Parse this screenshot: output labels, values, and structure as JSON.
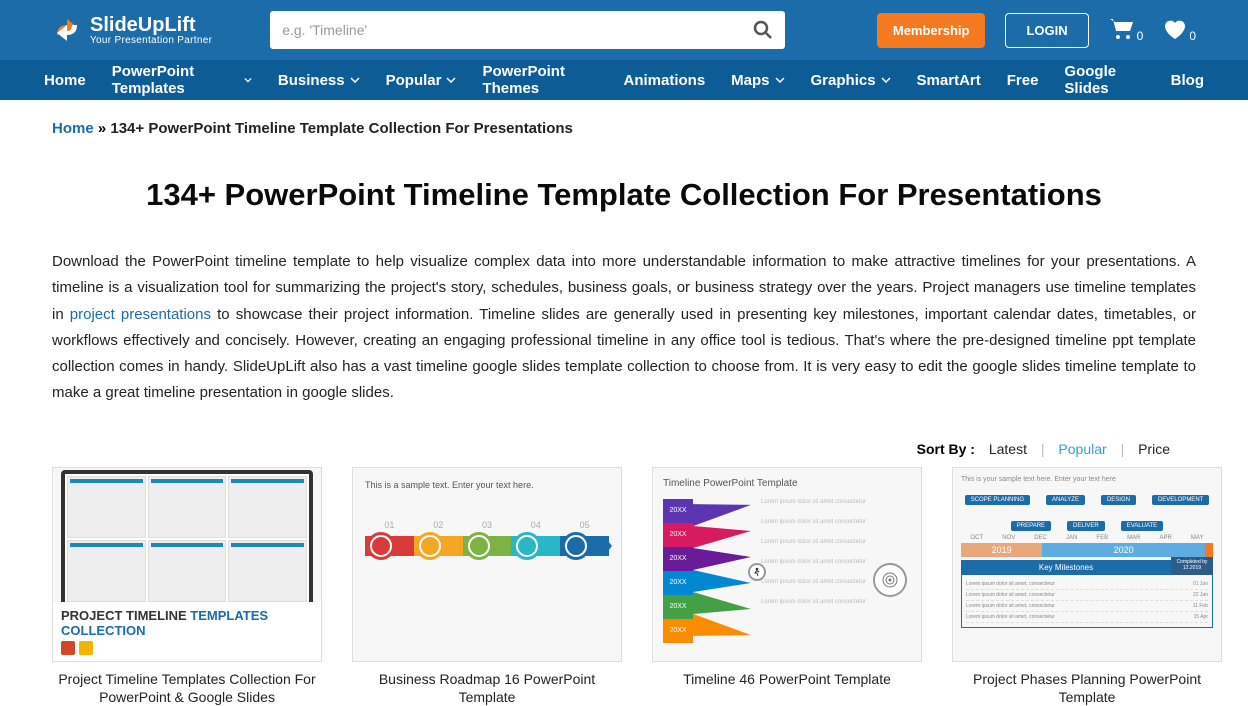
{
  "header": {
    "logo_title": "SlideUpLift",
    "logo_sub": "Your Presentation Partner",
    "search_placeholder": "e.g. 'Timeline'",
    "membership": "Membership",
    "login": "LOGIN",
    "cart_count": "0",
    "heart_count": "0"
  },
  "nav": {
    "items": [
      "Home",
      "PowerPoint Templates",
      "Business",
      "Popular",
      "PowerPoint Themes",
      "Animations",
      "Maps",
      "Graphics",
      "SmartArt",
      "Free",
      "Google Slides",
      "Blog"
    ],
    "dropdowns": [
      false,
      true,
      true,
      true,
      false,
      false,
      true,
      true,
      false,
      false,
      false,
      false
    ]
  },
  "breadcrumb": {
    "home": "Home",
    "sep": "»",
    "current": "134+ PowerPoint Timeline Template Collection For Presentations"
  },
  "page_title": "134+ PowerPoint Timeline Template Collection For Presentations",
  "desc": {
    "part1": "Download the PowerPoint timeline template to help visualize complex data into more understandable information to make attractive timelines for your presentations. A timeline is a visualization tool for summarizing the project's story, schedules, business goals, or business strategy over the years. Project managers use timeline templates in ",
    "link": "project presentations",
    "part2": " to showcase their project information. Timeline slides are generally used in presenting key milestones,  important calendar dates, timetables, or workflows effectively and concisely. However, creating an engaging professional timeline in any office tool is tedious. That's where the pre-designed timeline ppt template collection comes in handy. SlideUpLift also has a vast timeline google slides template collection to choose from. It is very easy to edit the google slides timeline template to make a great timeline presentation in google slides."
  },
  "sort": {
    "label": "Sort By :",
    "latest": "Latest",
    "popular": "Popular",
    "price": "Price"
  },
  "cards": [
    {
      "title": "Project Timeline Templates Collection For PowerPoint & Google Slides",
      "thumb_title1": "PROJECT TIMELINE ",
      "thumb_title2": "TEMPLATES",
      "thumb_title3": "COLLECTION"
    },
    {
      "title": "Business Roadmap 16 PowerPoint Template",
      "sample": "This is a sample text. Enter your text here.",
      "nums": [
        "01",
        "02",
        "03",
        "04",
        "05"
      ],
      "colors": [
        "#d93a3a",
        "#f5a623",
        "#7cb342",
        "#29b6c6",
        "#1b6ca8"
      ]
    },
    {
      "title": "Timeline 46 PowerPoint Template",
      "heading": "Timeline PowerPoint Template",
      "years": [
        "20XX",
        "20XX",
        "20XX",
        "20XX",
        "20XX",
        "20XX"
      ],
      "colors": [
        "#5e35b1",
        "#d81b60",
        "#6a1b9a",
        "#0288d1",
        "#43a047",
        "#fb8c00"
      ],
      "lorem": "Lorem ipsum dolor sit amet consectetur"
    },
    {
      "title": "Project Phases Planning PowerPoint Template",
      "sample": "This is your sample text here. Enter your text here",
      "chips": [
        "SCOPE PLANNING",
        "ANALYZE",
        "DESIGN",
        "DEVELOPMENT",
        "PREPARE",
        "DELIVER",
        "EVALUATE"
      ],
      "months": [
        "OCT",
        "NOV",
        "DEC",
        "JAN",
        "FEB",
        "MAR",
        "APR",
        "MAY"
      ],
      "year1": "2019",
      "year2": "2020",
      "km": "Key Milestones",
      "km_sub": "Completed by",
      "km_date": "12.2019",
      "rows": [
        {
          "l": "Lorem ipsum dolor sit amet, consectetur",
          "r": "01 Jan"
        },
        {
          "l": "Lorem ipsum dolor sit amet, consectetur",
          "r": "22 Jan"
        },
        {
          "l": "Lorem ipsum dolor sit amet, consectetur",
          "r": "11 Feb"
        },
        {
          "l": "Lorem ipsum dolor sit amet, consectetur",
          "r": "15 Apr"
        }
      ]
    }
  ]
}
